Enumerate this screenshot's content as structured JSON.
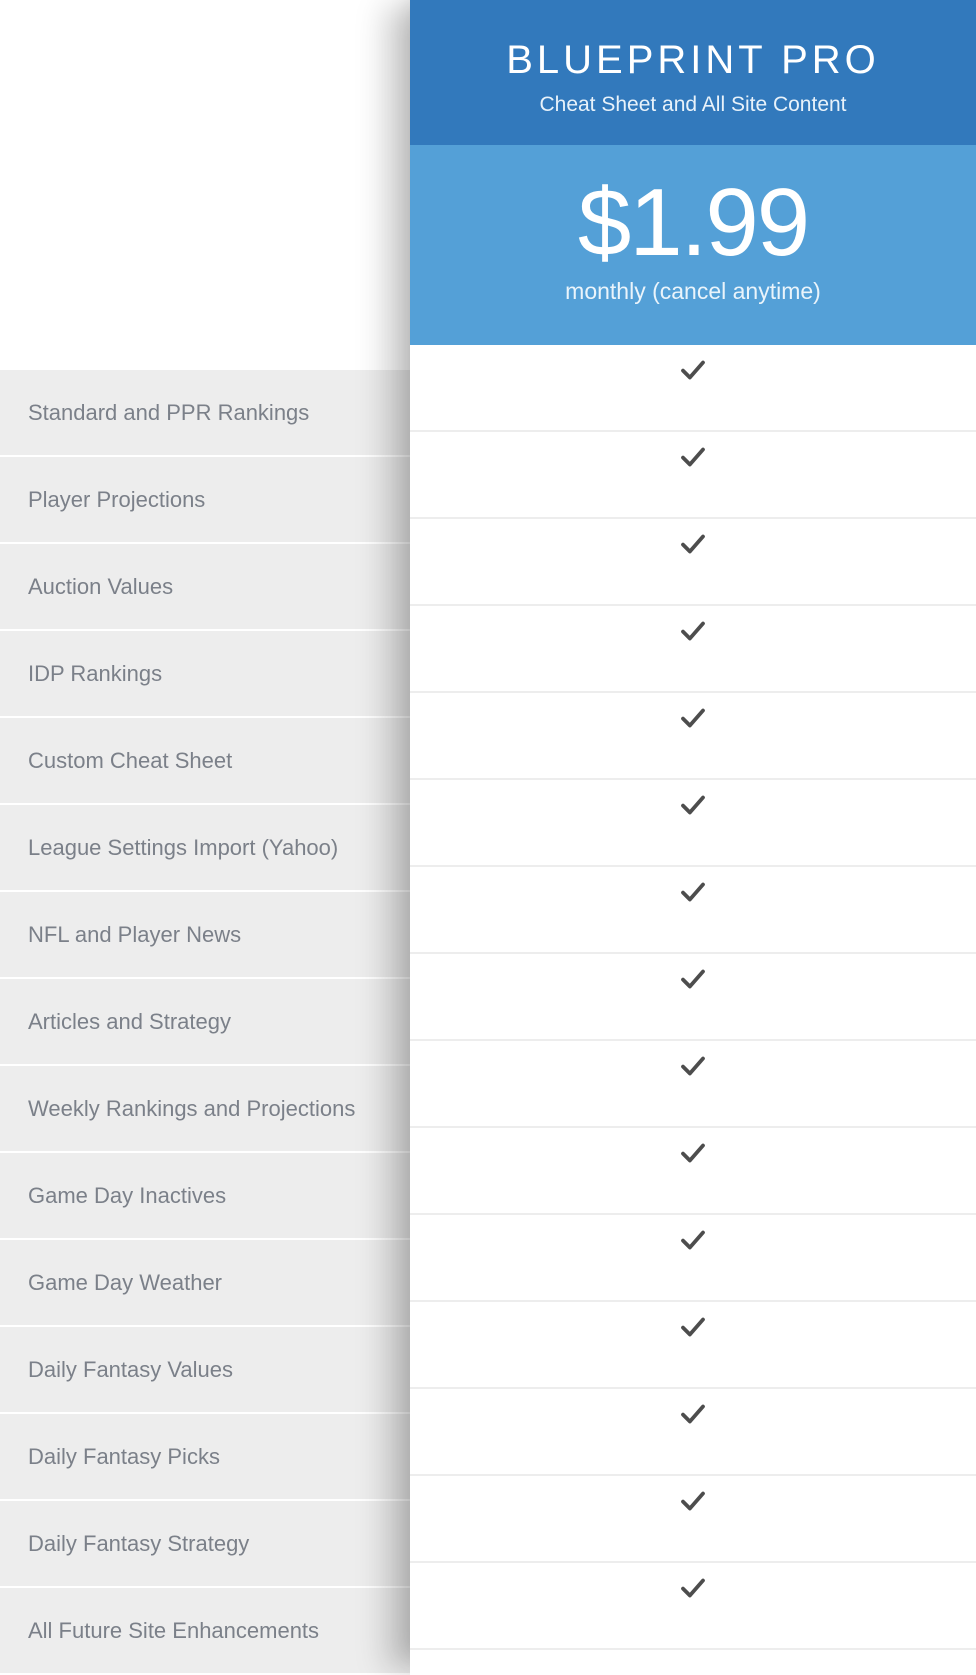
{
  "plan": {
    "title": "BLUEPRINT PRO",
    "subtitle": "Cheat Sheet and All Site Content",
    "price": "$1.99",
    "period": "monthly (cancel anytime)"
  },
  "features": [
    {
      "label": "Standard and PPR Rankings",
      "included": true
    },
    {
      "label": "Player Projections",
      "included": true
    },
    {
      "label": "Auction Values",
      "included": true
    },
    {
      "label": "IDP Rankings",
      "included": true
    },
    {
      "label": "Custom Cheat Sheet",
      "included": true
    },
    {
      "label": "League Settings Import (Yahoo)",
      "included": true
    },
    {
      "label": "NFL and Player News",
      "included": true
    },
    {
      "label": "Articles and Strategy",
      "included": true
    },
    {
      "label": "Weekly Rankings and Projections",
      "included": true
    },
    {
      "label": "Game Day Inactives",
      "included": true
    },
    {
      "label": "Game Day Weather",
      "included": true
    },
    {
      "label": "Daily Fantasy Values",
      "included": true
    },
    {
      "label": "Daily Fantasy Picks",
      "included": true
    },
    {
      "label": "Daily Fantasy Strategy",
      "included": true
    },
    {
      "label": "All Future Site Enhancements",
      "included": true
    }
  ]
}
